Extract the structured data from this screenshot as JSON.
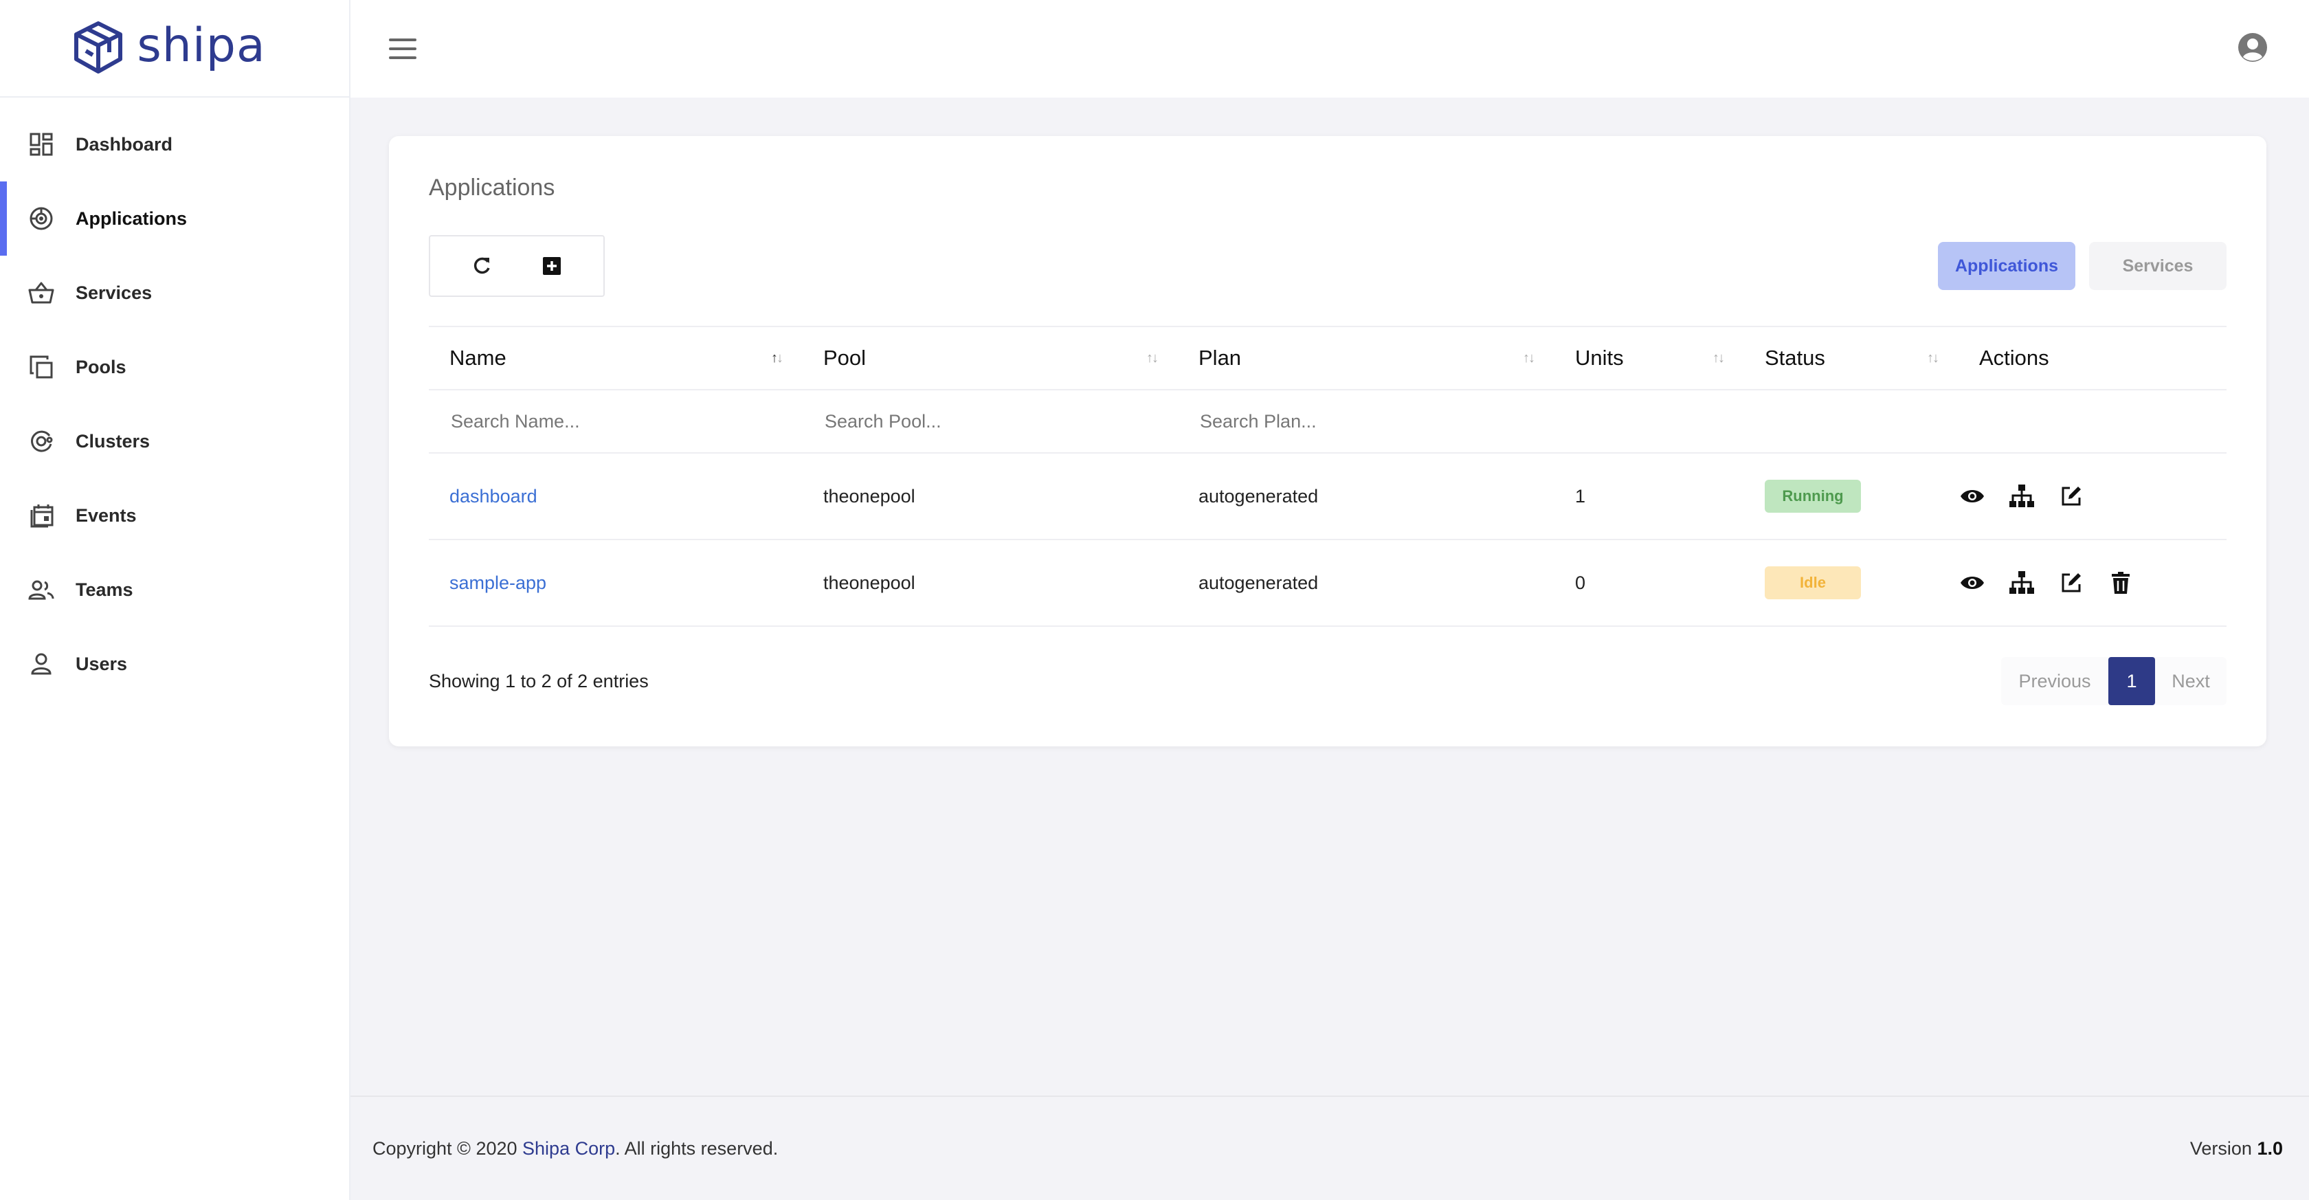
{
  "brand": {
    "name": "shipa"
  },
  "sidebar": {
    "items": [
      {
        "label": "Dashboard",
        "icon": "dashboard-icon",
        "active": false
      },
      {
        "label": "Applications",
        "icon": "applications-icon",
        "active": true
      },
      {
        "label": "Services",
        "icon": "basket-icon",
        "active": false
      },
      {
        "label": "Pools",
        "icon": "pools-icon",
        "active": false
      },
      {
        "label": "Clusters",
        "icon": "clusters-icon",
        "active": false
      },
      {
        "label": "Events",
        "icon": "calendar-icon",
        "active": false
      },
      {
        "label": "Teams",
        "icon": "teams-icon",
        "active": false
      },
      {
        "label": "Users",
        "icon": "user-icon",
        "active": false
      }
    ]
  },
  "card": {
    "title": "Applications",
    "segments": {
      "applications": "Applications",
      "services": "Services"
    }
  },
  "table": {
    "columns": [
      "Name",
      "Pool",
      "Plan",
      "Units",
      "Status",
      "Actions"
    ],
    "search": {
      "name": "Search Name...",
      "pool": "Search Pool...",
      "plan": "Search Plan..."
    },
    "rows": [
      {
        "name": "dashboard",
        "pool": "theonepool",
        "plan": "autogenerated",
        "units": "1",
        "status": "Running"
      },
      {
        "name": "sample-app",
        "pool": "theonepool",
        "plan": "autogenerated",
        "units": "0",
        "status": "Idle"
      }
    ]
  },
  "pagination": {
    "summary": "Showing 1 to 2 of 2 entries",
    "previous": "Previous",
    "page": "1",
    "next": "Next"
  },
  "footer": {
    "copyright_prefix": "Copyright © 2020",
    "company": "Shipa Corp",
    "copyright_suffix": ". All rights reserved.",
    "version_label": "Version",
    "version": "1.0"
  },
  "colors": {
    "brand": "#2e3b8f",
    "accent": "#5a6df0",
    "link": "#3b6fd4",
    "running_bg": "#bfe6bf",
    "idle_bg": "#fde7b8"
  }
}
